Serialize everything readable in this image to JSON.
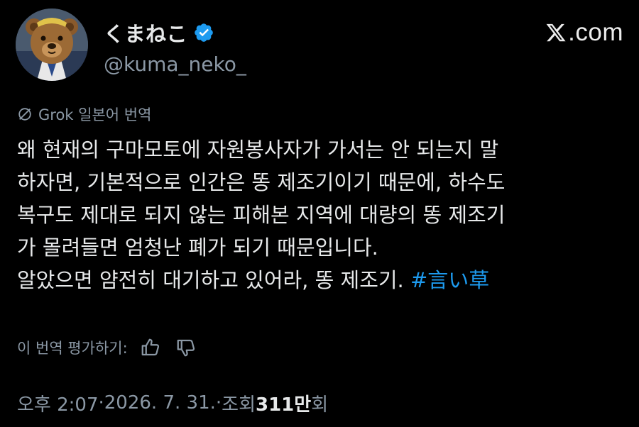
{
  "author": {
    "display_name": "くまねこ",
    "handle": "@kuma_neko_",
    "verified": true,
    "avatar_icon": "bear-avatar"
  },
  "brand": {
    "site": ".com",
    "logo_icon": "x-logo-icon"
  },
  "translation": {
    "label": "Grok 일본어 번역"
  },
  "post": {
    "lines": [
      "왜 현재의 구마모토에 자원봉사자가 가서는 안 되는지 말",
      "하자면, 기본적으로 인간은 똥 제조기이기 때문에, 하수도",
      "복구도 제대로 되지 않는 피해본 지역에 대량의 똥 제조기",
      "가 몰려들면 엄청난 폐가 되기 때문입니다.",
      "알았으면 얌전히 대기하고 있어라, 똥 제조기. "
    ],
    "hashtag": "#言い草"
  },
  "rating": {
    "label": "이 번역 평가하기:"
  },
  "meta": {
    "time": "오후 2:07",
    "sep1": " · ",
    "date": "2026. 7. 31.",
    "sep2": " · ",
    "views_label": "조회 ",
    "views_count": "311만",
    "views_suffix": "회"
  },
  "colors": {
    "background": "#000000",
    "text": "#e7e9ea",
    "secondary": "#8b98a5",
    "accent": "#1d9bf0"
  }
}
